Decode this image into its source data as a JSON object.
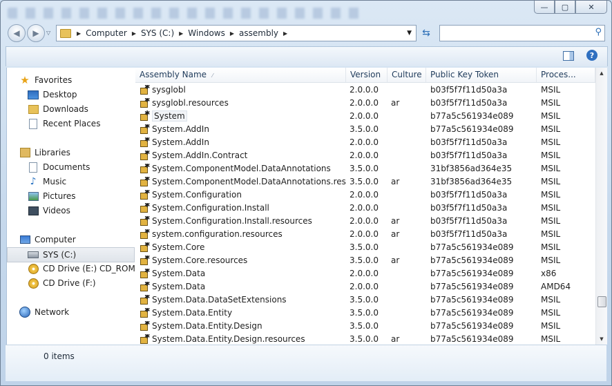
{
  "window": {
    "caption_buttons": {
      "minimize": "—",
      "maximize": "▢",
      "close": "✕"
    }
  },
  "address": {
    "crumbs": [
      "Computer",
      "SYS (C:)",
      "Windows",
      "assembly"
    ],
    "search_placeholder": ""
  },
  "nav": {
    "favorites": {
      "label": "Favorites",
      "items": [
        "Desktop",
        "Downloads",
        "Recent Places"
      ]
    },
    "libraries": {
      "label": "Libraries",
      "items": [
        "Documents",
        "Music",
        "Pictures",
        "Videos"
      ]
    },
    "computer": {
      "label": "Computer",
      "items": [
        "SYS (C:)",
        "CD Drive (E:) CD_ROM",
        "CD Drive (F:)"
      ]
    },
    "network": {
      "label": "Network"
    }
  },
  "columns": {
    "name": "Assembly Name",
    "version": "Version",
    "culture": "Culture",
    "key": "Public Key Token",
    "proc": "Proces..."
  },
  "rows": [
    {
      "name": "sysglobl",
      "version": "2.0.0.0",
      "culture": "",
      "key": "b03f5f7f11d50a3a",
      "proc": "MSIL"
    },
    {
      "name": "sysglobl.resources",
      "version": "2.0.0.0",
      "culture": "ar",
      "key": "b03f5f7f11d50a3a",
      "proc": "MSIL"
    },
    {
      "name": "System",
      "version": "2.0.0.0",
      "culture": "",
      "key": "b77a5c561934e089",
      "proc": "MSIL"
    },
    {
      "name": "System.AddIn",
      "version": "3.5.0.0",
      "culture": "",
      "key": "b77a5c561934e089",
      "proc": "MSIL"
    },
    {
      "name": "System.AddIn",
      "version": "2.0.0.0",
      "culture": "",
      "key": "b03f5f7f11d50a3a",
      "proc": "MSIL"
    },
    {
      "name": "System.AddIn.Contract",
      "version": "2.0.0.0",
      "culture": "",
      "key": "b03f5f7f11d50a3a",
      "proc": "MSIL"
    },
    {
      "name": "System.ComponentModel.DataAnnotations",
      "version": "3.5.0.0",
      "culture": "",
      "key": "31bf3856ad364e35",
      "proc": "MSIL"
    },
    {
      "name": "System.ComponentModel.DataAnnotations.resour...",
      "version": "3.5.0.0",
      "culture": "ar",
      "key": "31bf3856ad364e35",
      "proc": "MSIL"
    },
    {
      "name": "System.Configuration",
      "version": "2.0.0.0",
      "culture": "",
      "key": "b03f5f7f11d50a3a",
      "proc": "MSIL"
    },
    {
      "name": "System.Configuration.Install",
      "version": "2.0.0.0",
      "culture": "",
      "key": "b03f5f7f11d50a3a",
      "proc": "MSIL"
    },
    {
      "name": "System.Configuration.Install.resources",
      "version": "2.0.0.0",
      "culture": "ar",
      "key": "b03f5f7f11d50a3a",
      "proc": "MSIL"
    },
    {
      "name": "system.configuration.resources",
      "version": "2.0.0.0",
      "culture": "ar",
      "key": "b03f5f7f11d50a3a",
      "proc": "MSIL"
    },
    {
      "name": "System.Core",
      "version": "3.5.0.0",
      "culture": "",
      "key": "b77a5c561934e089",
      "proc": "MSIL"
    },
    {
      "name": "System.Core.resources",
      "version": "3.5.0.0",
      "culture": "ar",
      "key": "b77a5c561934e089",
      "proc": "MSIL"
    },
    {
      "name": "System.Data",
      "version": "2.0.0.0",
      "culture": "",
      "key": "b77a5c561934e089",
      "proc": "x86"
    },
    {
      "name": "System.Data",
      "version": "2.0.0.0",
      "culture": "",
      "key": "b77a5c561934e089",
      "proc": "AMD64"
    },
    {
      "name": "System.Data.DataSetExtensions",
      "version": "3.5.0.0",
      "culture": "",
      "key": "b77a5c561934e089",
      "proc": "MSIL"
    },
    {
      "name": "System.Data.Entity",
      "version": "3.5.0.0",
      "culture": "",
      "key": "b77a5c561934e089",
      "proc": "MSIL"
    },
    {
      "name": "System.Data.Entity.Design",
      "version": "3.5.0.0",
      "culture": "",
      "key": "b77a5c561934e089",
      "proc": "MSIL"
    },
    {
      "name": "System.Data.Entity.Design.resources",
      "version": "3.5.0.0",
      "culture": "ar",
      "key": "b77a5c561934e089",
      "proc": "MSIL"
    }
  ],
  "details": {
    "count": "0 items"
  },
  "help": "?"
}
